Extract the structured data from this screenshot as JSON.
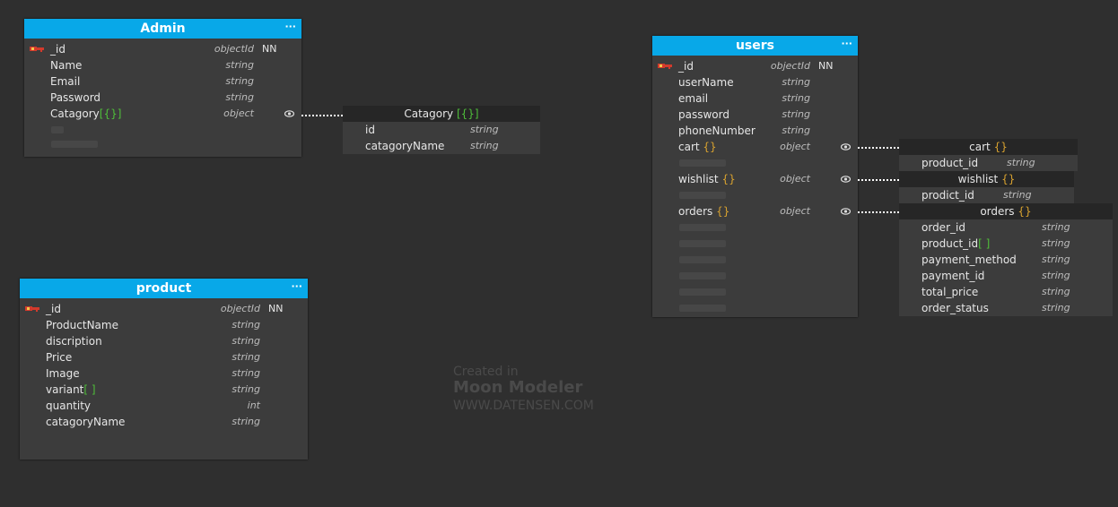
{
  "admin": {
    "title": "Admin",
    "menu": "···",
    "fields": [
      {
        "name": "_id",
        "type": "objectId",
        "nn": "NN",
        "key": true
      },
      {
        "name": "Name",
        "type": "string"
      },
      {
        "name": "Email",
        "type": "string"
      },
      {
        "name": "Password",
        "type": "string"
      },
      {
        "name": "Catagory",
        "suffix": "[{}]",
        "type": "object",
        "linked": true
      }
    ]
  },
  "catagory": {
    "title": "Catagory",
    "suffix": "[{}]",
    "fields": [
      {
        "name": "id",
        "type": "string"
      },
      {
        "name": "catagoryName",
        "type": "string"
      }
    ]
  },
  "product": {
    "title": "product",
    "menu": "···",
    "fields": [
      {
        "name": "_id",
        "type": "objectId",
        "nn": "NN",
        "key": true
      },
      {
        "name": "ProductName",
        "type": "string"
      },
      {
        "name": "discription",
        "type": "string"
      },
      {
        "name": "Price",
        "type": "string"
      },
      {
        "name": "Image",
        "type": "string"
      },
      {
        "name": "variant",
        "suffix": "[ ]",
        "type": "string"
      },
      {
        "name": "quantity",
        "type": "int"
      },
      {
        "name": "catagoryName",
        "type": "string"
      }
    ]
  },
  "users": {
    "title": "users",
    "menu": "···",
    "fields": [
      {
        "name": "_id",
        "type": "objectId",
        "nn": "NN",
        "key": true
      },
      {
        "name": "userName",
        "type": "string"
      },
      {
        "name": "email",
        "type": "string"
      },
      {
        "name": "password",
        "type": "string"
      },
      {
        "name": "phoneNumber",
        "type": "string"
      },
      {
        "name": "cart",
        "suffix": "{}",
        "type": "object",
        "linked": true
      },
      {
        "name": "wishlist",
        "suffix": "{}",
        "type": "object",
        "linked": true
      },
      {
        "name": "orders",
        "suffix": "{}",
        "type": "object",
        "linked": true
      }
    ]
  },
  "cart": {
    "title": "cart",
    "suffix": "{}",
    "fields": [
      {
        "name": "product_id",
        "type": "string"
      }
    ]
  },
  "wishlist": {
    "title": "wishlist",
    "suffix": "{}",
    "fields": [
      {
        "name": "prodict_id",
        "type": "string"
      }
    ]
  },
  "orders": {
    "title": "orders",
    "suffix": "{}",
    "fields": [
      {
        "name": "order_id",
        "type": "string"
      },
      {
        "name": "product_id",
        "suffix": "[ ]",
        "type": "string"
      },
      {
        "name": "payment_method",
        "type": "string"
      },
      {
        "name": "payment_id",
        "type": "string"
      },
      {
        "name": "total_price",
        "type": "string"
      },
      {
        "name": "order_status",
        "type": "string"
      }
    ]
  },
  "watermark": {
    "line1": "Created in",
    "line2": "Moon Modeler",
    "line3": "WWW.DATENSEN.COM"
  },
  "colors": {
    "header": "#08a8e8",
    "background": "#2f2f2f",
    "table_body": "#3c3c3c",
    "object_bracket": "#d8a22f",
    "array_bracket": "#4fbf3a",
    "key_icon": "#d33a2c"
  }
}
